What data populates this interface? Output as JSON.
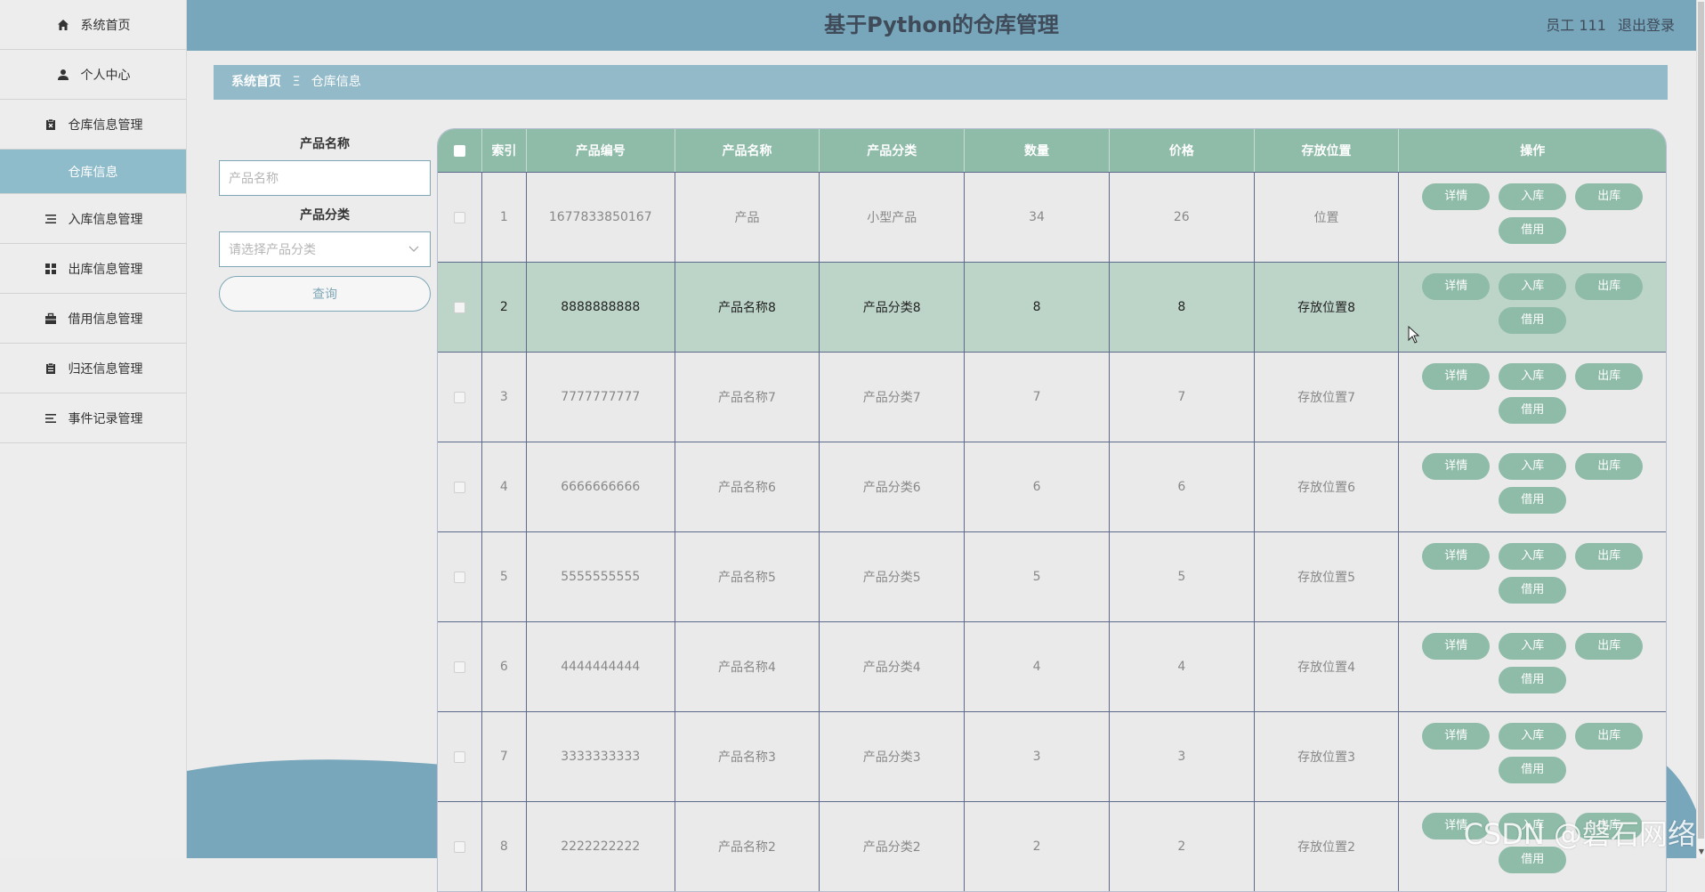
{
  "header": {
    "title": "基于Python的仓库管理",
    "user": "员工 111",
    "logout": "退出登录"
  },
  "sidebar": {
    "items": [
      {
        "label": "系统首页",
        "icon": "home-icon"
      },
      {
        "label": "个人中心",
        "icon": "user-icon"
      },
      {
        "label": "仓库信息管理",
        "icon": "clipboard-x-icon"
      },
      {
        "label": "仓库信息",
        "icon": ""
      },
      {
        "label": "入库信息管理",
        "icon": "list-icon"
      },
      {
        "label": "出库信息管理",
        "icon": "grid-icon"
      },
      {
        "label": "借用信息管理",
        "icon": "briefcase-icon"
      },
      {
        "label": "归还信息管理",
        "icon": "clipboard-icon"
      },
      {
        "label": "事件记录管理",
        "icon": "menu-icon"
      }
    ]
  },
  "breadcrumb": {
    "home": "系统首页",
    "separator": "Ξ",
    "current": "仓库信息"
  },
  "search": {
    "name_label": "产品名称",
    "name_placeholder": "产品名称",
    "category_label": "产品分类",
    "category_placeholder": "请选择产品分类",
    "query_button": "查询"
  },
  "table": {
    "headers": [
      "索引",
      "产品编号",
      "产品名称",
      "产品分类",
      "数量",
      "价格",
      "存放位置",
      "操作"
    ],
    "actions": {
      "detail": "详情",
      "in": "入库",
      "out": "出库",
      "borrow": "借用"
    },
    "rows": [
      {
        "index": "1",
        "code": "1677833850167",
        "name": "产品",
        "category": "小型产品",
        "qty": "34",
        "price": "26",
        "location": "位置"
      },
      {
        "index": "2",
        "code": "8888888888",
        "name": "产品名称8",
        "category": "产品分类8",
        "qty": "8",
        "price": "8",
        "location": "存放位置8"
      },
      {
        "index": "3",
        "code": "7777777777",
        "name": "产品名称7",
        "category": "产品分类7",
        "qty": "7",
        "price": "7",
        "location": "存放位置7"
      },
      {
        "index": "4",
        "code": "6666666666",
        "name": "产品名称6",
        "category": "产品分类6",
        "qty": "6",
        "price": "6",
        "location": "存放位置6"
      },
      {
        "index": "5",
        "code": "5555555555",
        "name": "产品名称5",
        "category": "产品分类5",
        "qty": "5",
        "price": "5",
        "location": "存放位置5"
      },
      {
        "index": "6",
        "code": "4444444444",
        "name": "产品名称4",
        "category": "产品分类4",
        "qty": "4",
        "price": "4",
        "location": "存放位置4"
      },
      {
        "index": "7",
        "code": "3333333333",
        "name": "产品名称3",
        "category": "产品分类3",
        "qty": "3",
        "price": "3",
        "location": "存放位置3"
      },
      {
        "index": "8",
        "code": "2222222222",
        "name": "产品名称2",
        "category": "产品分类2",
        "qty": "2",
        "price": "2",
        "location": "存放位置2"
      }
    ]
  },
  "watermark": "CSDN @磐石网络",
  "colors": {
    "header": "#78a6bb",
    "accent": "#8fbba9",
    "breadcrumb": "#92bac9"
  }
}
